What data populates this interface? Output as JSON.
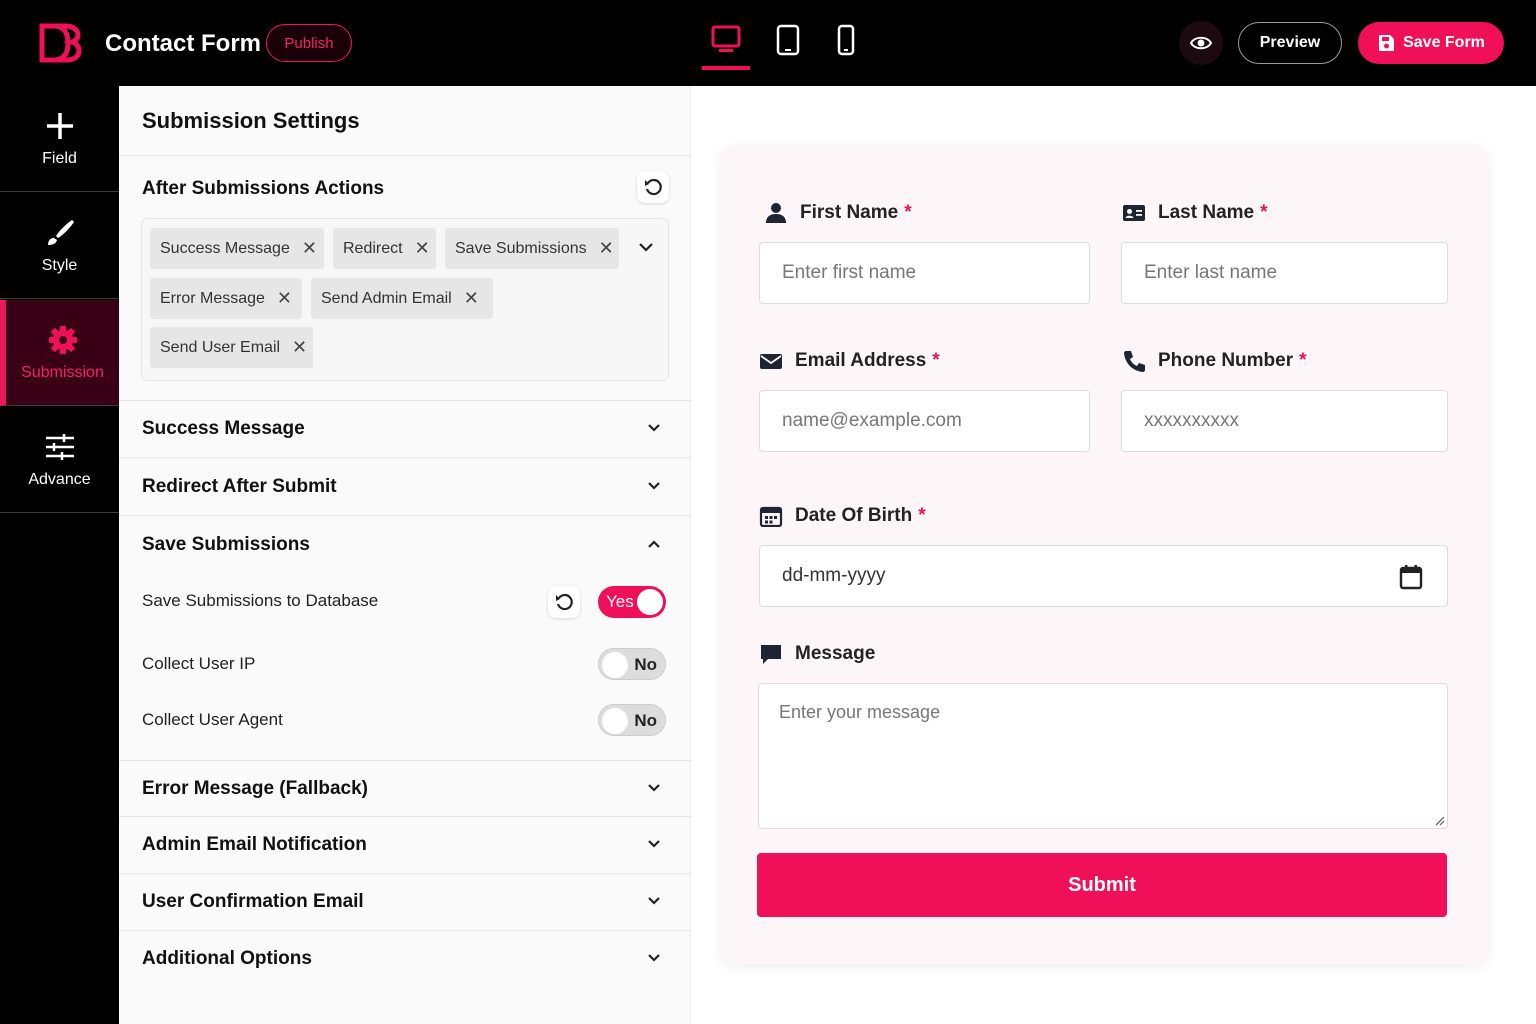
{
  "header": {
    "app_title": "Contact Form",
    "status_badge": "Publish",
    "preview_label": "Preview",
    "save_label": "Save Form"
  },
  "leftnav": {
    "items": [
      {
        "label": "Field",
        "icon": "plus-icon"
      },
      {
        "label": "Style",
        "icon": "brush-icon"
      },
      {
        "label": "Submission",
        "icon": "gear-icon",
        "active": true
      },
      {
        "label": "Advance",
        "icon": "sliders-icon"
      }
    ]
  },
  "panel": {
    "title": "Submission Settings",
    "after_actions": {
      "heading": "After Submissions Actions",
      "tags": [
        "Success Message",
        "Redirect",
        "Save Submissions",
        "Error Message",
        "Send Admin Email",
        "Send User Email"
      ]
    },
    "sections": {
      "success_message": "Success Message",
      "redirect": "Redirect After Submit",
      "save_submissions": "Save Submissions",
      "error_message": "Error Message (Fallback)",
      "admin_email": "Admin Email Notification",
      "user_email": "User Confirmation Email",
      "additional": "Additional Options"
    },
    "save_rows": [
      {
        "label": "Save Submissions to Database",
        "value": "Yes"
      },
      {
        "label": "Collect User IP",
        "value": "No"
      },
      {
        "label": "Collect User Agent",
        "value": "No"
      }
    ]
  },
  "form": {
    "first_name": {
      "label": "First Name",
      "placeholder": "Enter first name",
      "required": "*"
    },
    "last_name": {
      "label": "Last Name",
      "placeholder": "Enter last name",
      "required": "*"
    },
    "email": {
      "label": "Email Address",
      "placeholder": "name@example.com",
      "required": "*"
    },
    "phone": {
      "label": "Phone Number",
      "placeholder": "xxxxxxxxxx",
      "required": "*"
    },
    "dob": {
      "label": "Date Of Birth",
      "placeholder": "dd-mm-yyyy",
      "required": "*"
    },
    "message": {
      "label": "Message",
      "placeholder": "Enter your message"
    },
    "submit_label": "Submit"
  },
  "colors": {
    "accent": "#f0105a",
    "topbar": "#000000"
  }
}
